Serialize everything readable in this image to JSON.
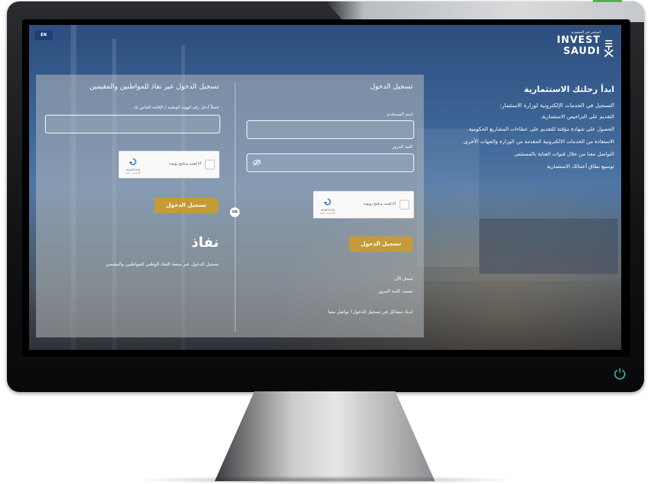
{
  "lang_button": "EN",
  "logo": {
    "tagline": "استثمر في السعودية",
    "line1": "INVEST",
    "line2": "SAUDI"
  },
  "info": {
    "title": "ابدأ رحلتك الاستثمارية",
    "subtitle": "التسجيل في الخدمات الإلكترونية لوزارة الاستثمار:",
    "items": [
      "التقديم على التراخيص الاستثمارية.",
      "الحصول على شهادة مؤقتة للتقديم على عطاءات المشاريع الحكومية.",
      "الاستفادة من الخدمات الالكترونية المقدمة من الوزارة والجهات الأخرى.",
      "التواصل معنا من خلال قنوات العناية بالمستثمر.",
      "توسيع نطاق أعمالك الاستثمارية"
    ]
  },
  "login": {
    "title": "تسجيل الدخول",
    "username_label": "اسم المستخدم",
    "password_label": "كلمة المرور",
    "button": "تسجيل الدخول",
    "register_link": "سجل الآن",
    "forgot_link": "نسيت كلمة المرور",
    "help_text": "لديك مشاكل في تسجيل الدخول؟ تواصل معنا"
  },
  "captcha": {
    "label": "أنا لست برنامج روبوت",
    "brand": "reCAPTCHA",
    "terms": "الخصوصية - البنود"
  },
  "or_label": "OR",
  "nafath": {
    "title": "تسجيل الدخول عبر نفاذ للمواطنين والمقيمين",
    "id_label": "فضلاً أدخل رقم الهوية الوطنية / الإقامة الخاص بك",
    "button": "تسجيل الدخول",
    "brand": "نفاذ",
    "description": "تسجيل الدخول عبر منصة النفاذ الوطني للمواطنين والمقيمين"
  },
  "colors": {
    "accent_gold": "#c49b36",
    "lang_button_bg": "#1f3f77",
    "power_icon": "#2fd2c1"
  }
}
